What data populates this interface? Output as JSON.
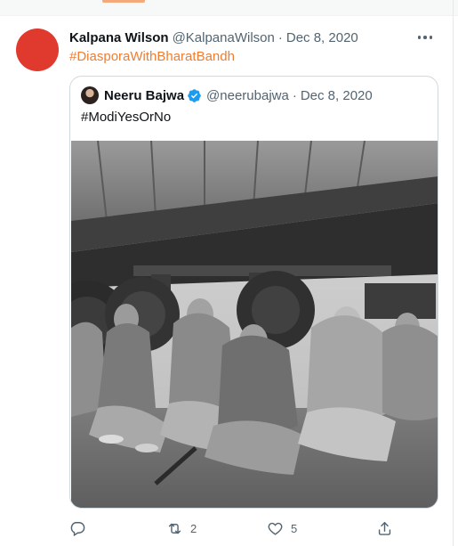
{
  "tweet": {
    "author_name": "Kalpana Wilson",
    "author_handle": "@KalpanaWilson",
    "separator": "·",
    "date": "Dec 8, 2020",
    "hashtag": "#DiasporaWithBharatBandh",
    "avatar_color": "#e0392e",
    "more_icon": "more-horizontal-icon"
  },
  "quoted": {
    "author_name": "Neeru Bajwa",
    "verified": true,
    "author_handle": "@neerubajwa",
    "separator": "·",
    "date": "Dec 8, 2020",
    "text": "#ModiYesOrNo",
    "media": "black-and-white photo of women seated on the ground beneath a truck trailer"
  },
  "actions": {
    "reply": {
      "icon": "reply-icon",
      "count": ""
    },
    "retweet": {
      "icon": "retweet-icon",
      "count": "2"
    },
    "like": {
      "icon": "heart-icon",
      "count": "5"
    },
    "share": {
      "icon": "share-icon",
      "count": ""
    }
  },
  "colors": {
    "accent": "#ef7d32",
    "verified": "#1d9bf0",
    "secondary_text": "#536471",
    "border": "#cfd9de"
  }
}
